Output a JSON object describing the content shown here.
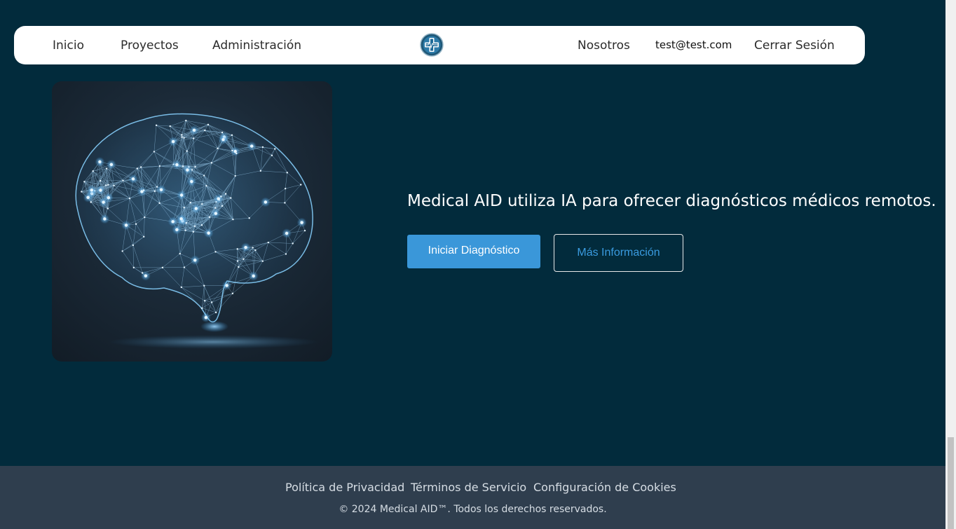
{
  "navbar": {
    "links_left": [
      "Inicio",
      "Proyectos",
      "Administración"
    ],
    "nosotros": "Nosotros",
    "email": "test@test.com",
    "logout": "Cerrar Sesión",
    "logo_icon": "medical-cross-logo"
  },
  "hero": {
    "image_icon": "glowing-brain-network",
    "headline": "Medical AID utiliza IA para ofrecer diagnósticos médicos remotos.",
    "primary_button": "Iniciar Diagnóstico",
    "secondary_button": "Más Información"
  },
  "footer": {
    "links": [
      "Política de Privacidad",
      "Términos de Servicio",
      "Configuración de Cookies"
    ],
    "copyright": "© 2024 Medical AID™. Todos los derechos reservados."
  },
  "colors": {
    "background": "#022b3c",
    "navbar": "#ffffff",
    "accent": "#3a97d9",
    "footer": "#2f3e4e"
  }
}
